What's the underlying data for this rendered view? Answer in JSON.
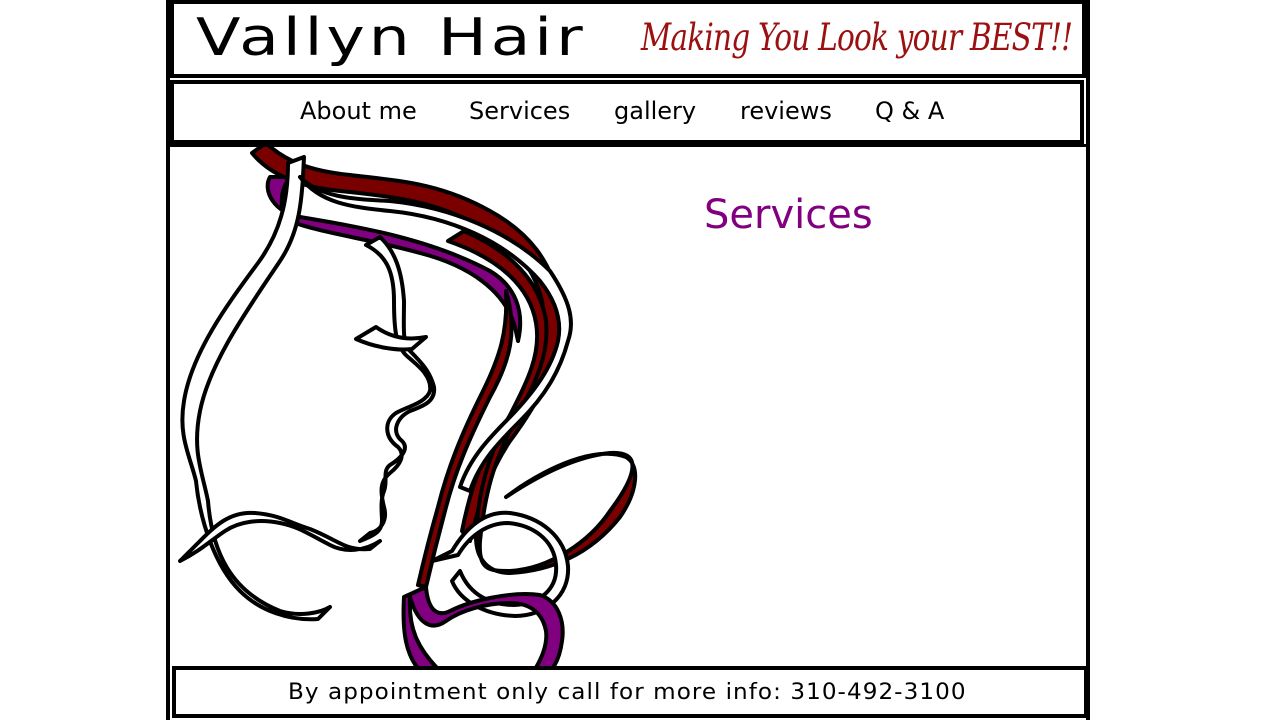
{
  "header": {
    "brand": "Vallyn Hair",
    "tagline": "Making You Look your BEST!!"
  },
  "nav": {
    "items": [
      {
        "label": "About me"
      },
      {
        "label": "Services"
      },
      {
        "label": "gallery"
      },
      {
        "label": "reviews"
      },
      {
        "label": "Q & A"
      }
    ]
  },
  "main": {
    "section_title": "Services",
    "illustration": "hair-ribbon-face-illustration"
  },
  "footer": {
    "text": "By appointment only call for more info: 310-492-3100"
  },
  "colors": {
    "tagline": "#9b1111",
    "section_title": "#800080",
    "ribbon_maroon": "#7a0000",
    "ribbon_purple": "#800080"
  }
}
